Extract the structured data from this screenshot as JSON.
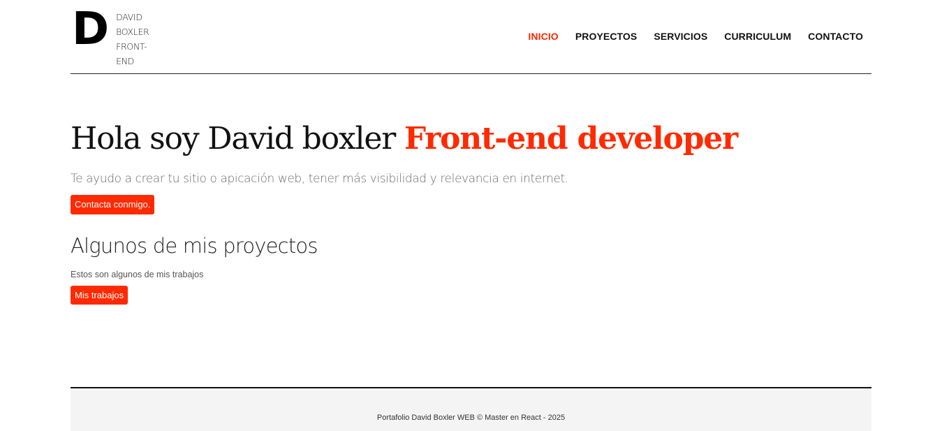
{
  "header": {
    "logo_letter": "D",
    "logo_text": "DAVID BOXLER FRONT-END",
    "nav": [
      {
        "label": "INICIO",
        "active": true
      },
      {
        "label": "PROYECTOS",
        "active": false
      },
      {
        "label": "SERVICIOS",
        "active": false
      },
      {
        "label": "CURRICULUM",
        "active": false
      },
      {
        "label": "CONTACTO",
        "active": false
      }
    ]
  },
  "hero": {
    "title_prefix": "Hola soy David boxler",
    "title_accent": "Front-end developer",
    "subtitle": "Te ayudo a crear tu sitio o apicación web, tener más visibilidad y relevancia en internet.",
    "contact_button": "Contacta conmigo."
  },
  "projects": {
    "title": "Algunos de mis proyectos",
    "description": "Estos son algunos de mis trabajos",
    "button": "Mis trabajos"
  },
  "footer": {
    "text": "Portafolio David Boxler WEB © Master en React - 2025"
  },
  "colors": {
    "accent": "#ff2a00",
    "text": "#111111",
    "footer_bg": "#f4f4f4"
  }
}
